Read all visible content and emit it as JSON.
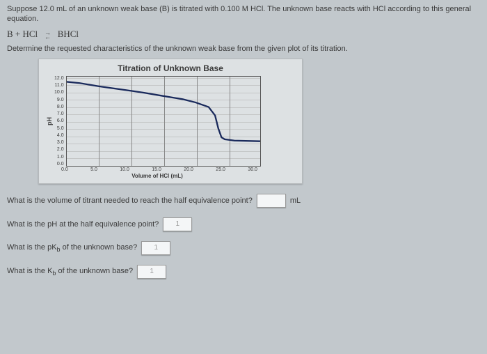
{
  "intro": {
    "line1": "Suppose 12.0 mL of an unknown weak base (B) is titrated with 0.100 M HCl. The unknown base reacts with HCl according to this general equation.",
    "eq_left": "B + HCl",
    "eq_right": "BHCl",
    "line2": "Determine the requested characteristics of the unknown weak base from the given plot of its titration."
  },
  "chart_data": {
    "type": "line",
    "title": "Titration of Unknown Base",
    "xlabel": "Volume of HCl (mL)",
    "ylabel": "pH",
    "x_ticks": [
      "0.0",
      "5.0",
      "10.0",
      "15.0",
      "20.0",
      "25.0",
      "30.0"
    ],
    "y_ticks": [
      "12.0",
      "11.0",
      "10.0",
      "9.0",
      "8.0",
      "7.0",
      "6.0",
      "5.0",
      "4.0",
      "3.0",
      "2.0",
      "1.0",
      "0.0"
    ],
    "xlim": [
      0,
      30
    ],
    "ylim": [
      0,
      12
    ],
    "series": [
      {
        "name": "titration-curve",
        "x": [
          0.0,
          2.0,
          5.0,
          10.0,
          12.0,
          15.0,
          18.0,
          20.0,
          22.0,
          23.0,
          23.5,
          24.0,
          24.5,
          26.0,
          30.0
        ],
        "y": [
          11.2,
          11.0,
          10.5,
          9.8,
          9.5,
          9.0,
          8.5,
          8.0,
          7.3,
          6.0,
          4.0,
          2.6,
          2.3,
          2.1,
          2.0
        ]
      }
    ]
  },
  "questions": {
    "q1": {
      "text": "What is the volume of titrant needed to reach the half equivalence point?",
      "placeholder": "",
      "unit": "mL"
    },
    "q2": {
      "text": "What is the pH at the half equivalence point?",
      "placeholder": "1",
      "unit": ""
    },
    "q3": {
      "text_a": "What is the pK",
      "sub": "b",
      "text_b": " of the unknown base?",
      "placeholder": "1",
      "unit": ""
    },
    "q4": {
      "text_a": "What is the K",
      "sub": "b",
      "text_b": " of the unknown base?",
      "placeholder": "1",
      "unit": ""
    }
  }
}
